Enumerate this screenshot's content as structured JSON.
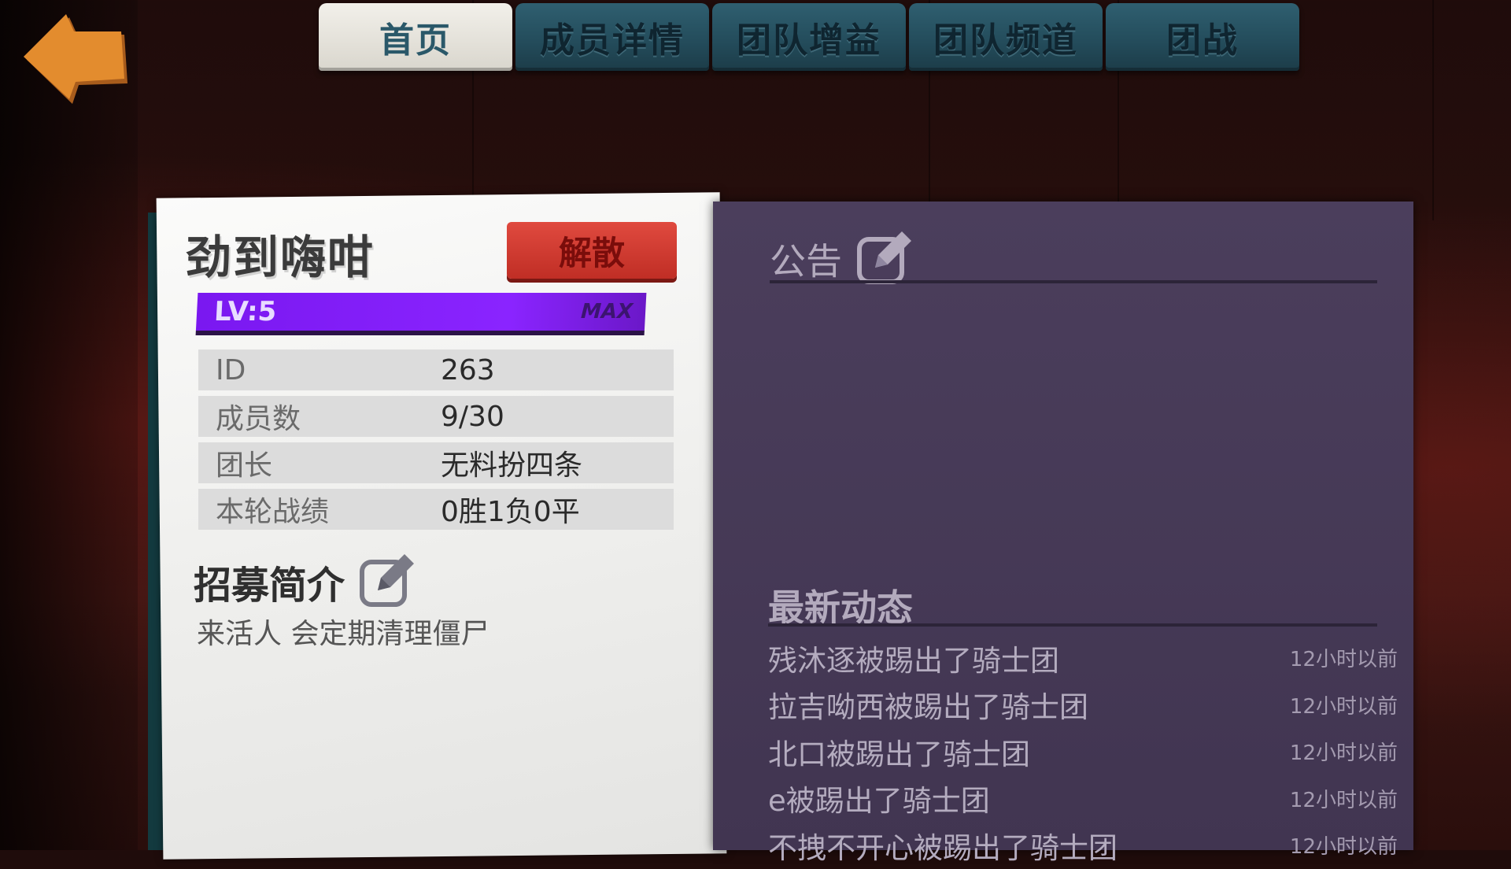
{
  "tabs": [
    {
      "label": "首页",
      "active": true
    },
    {
      "label": "成员详情",
      "active": false
    },
    {
      "label": "团队增益",
      "active": false
    },
    {
      "label": "团队频道",
      "active": false
    },
    {
      "label": "团战",
      "active": false
    }
  ],
  "guild": {
    "name": "劲到嗨咁",
    "disband_label": "解散",
    "level_label": "LV:5",
    "max_label": "MAX",
    "info": [
      {
        "key": "ID",
        "value": "263"
      },
      {
        "key": "成员数",
        "value": "9/30"
      },
      {
        "key": "团长",
        "value": "无料扮四条"
      },
      {
        "key": "本轮战绩",
        "value": "0胜1负0平"
      }
    ],
    "recruit_title": "招募简介",
    "recruit_text": "来活人 会定期清理僵尸"
  },
  "notice": {
    "title": "公告"
  },
  "news": {
    "title": "最新动态",
    "items": [
      {
        "text": "残沐逐被踢出了骑士团",
        "time": "12小时以前"
      },
      {
        "text": "拉吉呦西被踢出了骑士团",
        "time": "12小时以前"
      },
      {
        "text": "北口被踢出了骑士团",
        "time": "12小时以前"
      },
      {
        "text": "e被踢出了骑士团",
        "time": "12小时以前"
      },
      {
        "text": "不拽不开心被踢出了骑士团",
        "time": "12小时以前"
      }
    ]
  },
  "icons": {
    "back": "back-arrow-icon",
    "edit": "edit-pencil-icon"
  },
  "colors": {
    "tab_active": "#f2f0ea",
    "tab_inactive": "#2f5f70",
    "disband": "#d03a30",
    "level_bar": "#8a24ff",
    "panel": "#473a57",
    "back_arrow": "#e08a2e"
  }
}
